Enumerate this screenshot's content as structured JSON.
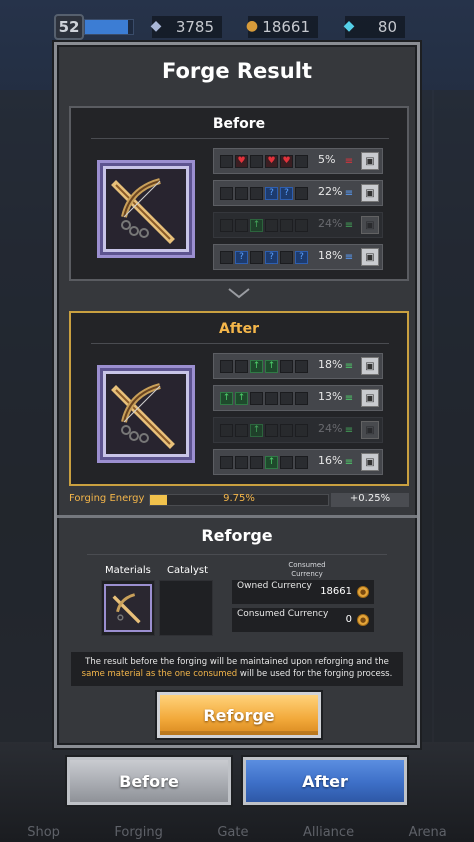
{
  "top_bar": {
    "level": "52",
    "xp_progress": 0.9,
    "resources": [
      {
        "icon": "energy-crystal-icon",
        "value": "3785"
      },
      {
        "icon": "gold-coin-icon",
        "value": "18661"
      },
      {
        "icon": "diamond-icon",
        "value": "80"
      }
    ]
  },
  "dialog": {
    "title": "Forge Result",
    "before": {
      "label": "Before",
      "options": [
        {
          "slots": [
            "empty",
            "red",
            "empty",
            "red",
            "red",
            "empty"
          ],
          "color": "red",
          "value": "5%",
          "locked": false
        },
        {
          "slots": [
            "empty",
            "empty",
            "empty",
            "blue",
            "blue",
            "empty"
          ],
          "color": "blue",
          "value": "22%",
          "locked": false
        },
        {
          "slots": [
            "empty",
            "empty",
            "green",
            "empty",
            "empty",
            "empty"
          ],
          "color": "green",
          "value": "24%",
          "locked": true
        },
        {
          "slots": [
            "empty",
            "blue",
            "empty",
            "blue",
            "empty",
            "blue"
          ],
          "color": "blue",
          "value": "18%",
          "locked": false
        }
      ]
    },
    "after": {
      "label": "After",
      "options": [
        {
          "slots": [
            "empty",
            "empty",
            "green",
            "green",
            "empty",
            "empty"
          ],
          "color": "green",
          "value": "18%",
          "locked": false
        },
        {
          "slots": [
            "green",
            "green",
            "empty",
            "empty",
            "empty",
            "empty"
          ],
          "color": "green",
          "value": "13%",
          "locked": false
        },
        {
          "slots": [
            "empty",
            "empty",
            "green",
            "empty",
            "empty",
            "empty"
          ],
          "color": "green",
          "value": "24%",
          "locked": true
        },
        {
          "slots": [
            "empty",
            "empty",
            "empty",
            "green",
            "empty",
            "empty"
          ],
          "color": "green",
          "value": "16%",
          "locked": false
        }
      ]
    },
    "energy": {
      "label": "Forging Energy",
      "percent_text": "9.75%",
      "fill": 0.0975,
      "gain": "+0.25%"
    },
    "reforge": {
      "title": "Reforge",
      "materials_label": "Materials",
      "catalyst_label": "Catalyst",
      "consumed_currency_header": "Consumed Currency",
      "owned_currency_label": "Owned Currency",
      "owned_currency_value": "18661",
      "consumed_currency_label": "Consumed Currency",
      "consumed_currency_value": "0",
      "notice_part1": "The result before the forging will be maintained upon reforging and the",
      "notice_highlight": "same material as the one consumed",
      "notice_part2": "will be used for the forging process.",
      "button_label": "Reforge"
    }
  },
  "choice_buttons": {
    "before_label": "Before",
    "after_label": "After"
  },
  "background_nav": [
    "Shop",
    "Forging",
    "Gate",
    "Alliance",
    "Arena"
  ],
  "colors": {
    "after_accent": "#f4b64a",
    "before_button": "#a9acb2",
    "after_button": "#3d6fc7",
    "reforge_button": "#f2a93a"
  }
}
